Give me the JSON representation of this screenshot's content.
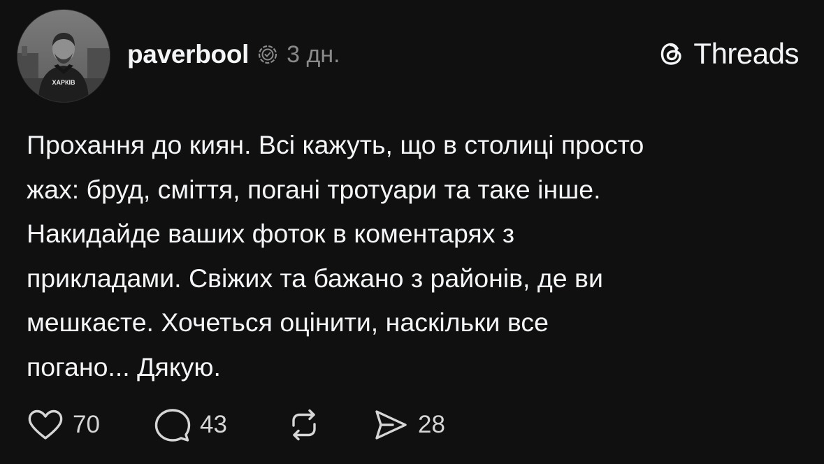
{
  "post": {
    "author": {
      "username": "paverbool",
      "verified_icon": "verified-badge-icon"
    },
    "timestamp": "3 дн.",
    "brand": {
      "name": "Threads",
      "icon": "threads-logo-icon"
    },
    "avatar": {
      "shirt_text": "ХАРКІВ"
    },
    "text_lines": [
      "Прохання до киян. Всі кажуть, що в столиці просто",
      "жах: бруд, сміття, погані тротуари та таке інше.",
      "Накидайде ваших фоток в коментарях з",
      "прикладами. Свіжих та бажано з районів, де ви",
      "мешкаєте. Хочеться оцінити, наскільки все",
      "погано... Дякую."
    ],
    "actions": {
      "likes": "70",
      "comments": "43",
      "reposts": "",
      "shares": "28"
    }
  },
  "colors": {
    "background": "#101010",
    "text": "#f3f5f7",
    "muted": "#8a8a8a"
  }
}
